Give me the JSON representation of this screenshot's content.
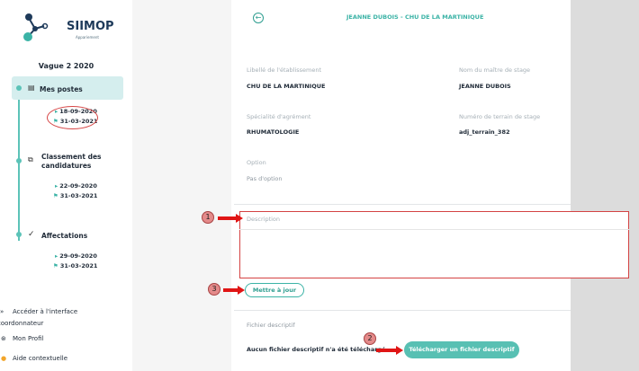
{
  "app": {
    "logo_text": "SIIMOP",
    "logo_sub": "Appariement"
  },
  "sidebar": {
    "vague": "Vague 2 2020",
    "sections": [
      {
        "label": "Mes postes",
        "start": "18-09-2020",
        "end": "31-03-2021"
      },
      {
        "label_line1": "Classement des",
        "label_line2": "candidatures",
        "start": "22-09-2020",
        "end": "31-03-2021"
      },
      {
        "label": "Affectations",
        "start": "29-09-2020",
        "end": "31-03-2021"
      }
    ],
    "links": {
      "interface_line1": "Accéder à l'interface",
      "interface_line2": "coordonnateur",
      "profil": "Mon Profil",
      "aide": "Aide contextuelle"
    }
  },
  "header": {
    "title": "JEANNE DUBOIS - CHU DE LA MARTINIQUE"
  },
  "form": {
    "etablissement_label": "Libellé de l'établissement",
    "etablissement_value": "CHU DE LA MARTINIQUE",
    "maitre_label": "Nom du maître de stage",
    "maitre_value": "JEANNE DUBOIS",
    "specialite_label": "Spécialité d'agrément",
    "specialite_value": "RHUMATOLOGIE",
    "terrain_label": "Numéro de terrain de stage",
    "terrain_value": "adj_terrain_382",
    "option_label": "Option",
    "option_value": "Pas d'option",
    "description_label": "Description",
    "description_value": "",
    "update_button": "Mettre à jour",
    "fichier_label": "Fichier descriptif",
    "fichier_value": "Aucun fichier descriptif n'a été téléchargé",
    "upload_button": "Télécharger un fichier descriptif"
  },
  "annotations": [
    "1",
    "2",
    "3"
  ],
  "colors": {
    "accent": "#3bb3a6",
    "annotation_red": "#e01515"
  }
}
